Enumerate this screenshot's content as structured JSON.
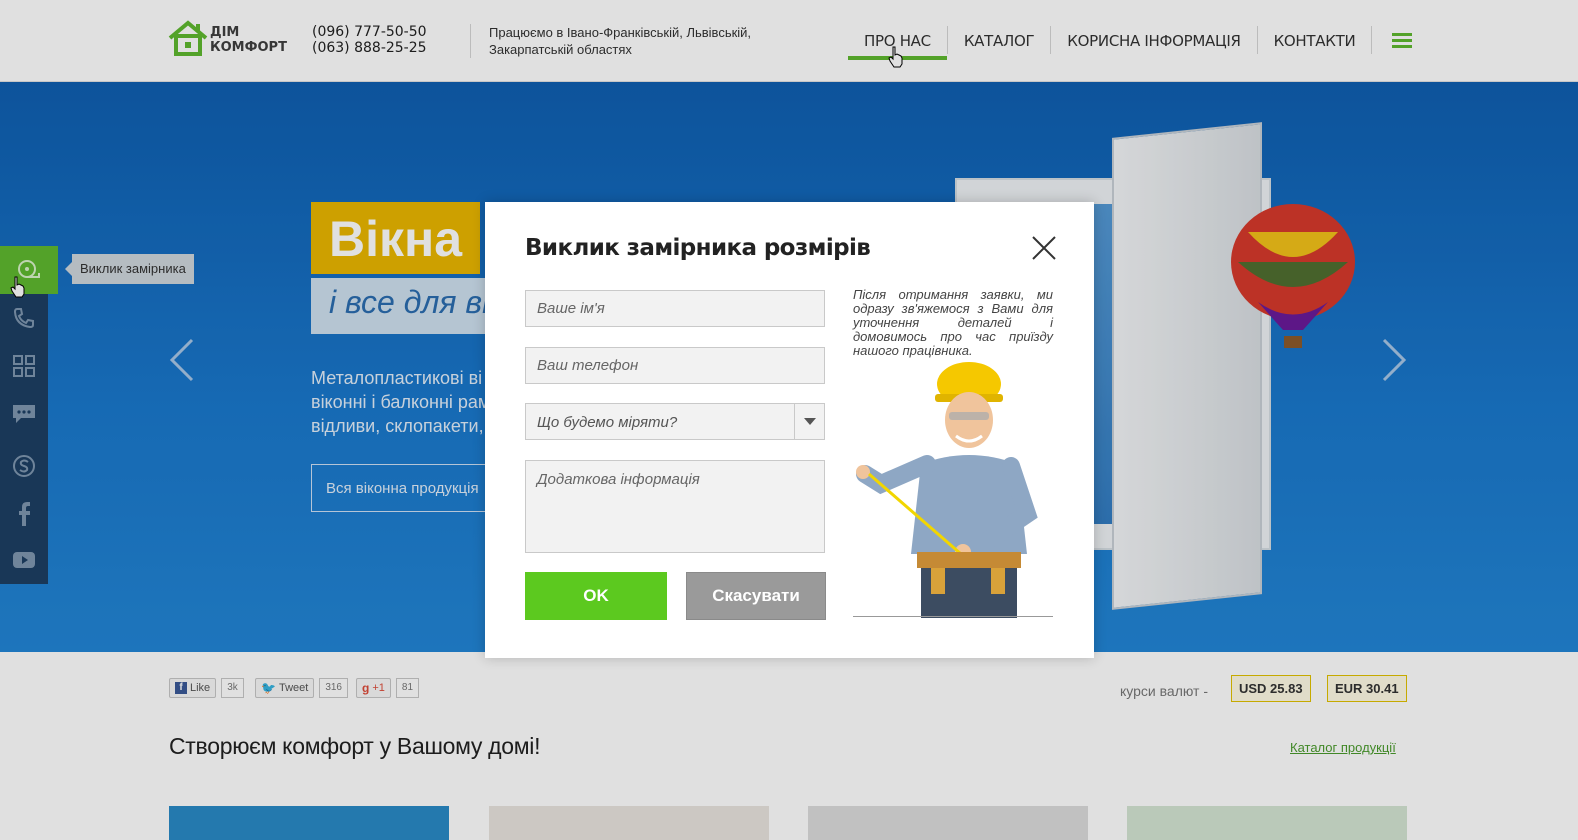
{
  "header": {
    "logo_text_line1": "ДІМ",
    "logo_text_line2": "КОМФОРТ",
    "phone1": "(096) 777-50-50",
    "phone2": "(063) 888-25-25",
    "regions": "Працюємо в Івано-Франківській, Львівській, Закарпатській областях",
    "nav": [
      {
        "label": "ПРО НАС",
        "active": true
      },
      {
        "label": "КАТАЛОГ",
        "active": false
      },
      {
        "label": "КОРИСНА ІНФОРМАЦІЯ",
        "active": false
      },
      {
        "label": "КОНТАКТИ",
        "active": false
      }
    ],
    "menu_icon": "hamburger-icon"
  },
  "hero": {
    "title": "Вікна",
    "subtitle": "і все для ві",
    "description_lines": [
      "Металопластикові ві",
      "віконні і балконні рам",
      "відливи, склопакети,"
    ],
    "button_label": "Вся віконна продукція"
  },
  "sidebar": {
    "items": [
      {
        "icon": "measure-tape-icon",
        "active": true
      },
      {
        "icon": "phone-icon",
        "active": false
      },
      {
        "icon": "grid-icon",
        "active": false
      },
      {
        "icon": "chat-icon",
        "active": false
      },
      {
        "icon": "skype-icon",
        "active": false
      },
      {
        "icon": "facebook-icon",
        "active": false
      },
      {
        "icon": "youtube-icon",
        "active": false
      }
    ],
    "tooltip": "Виклик замірника"
  },
  "social": {
    "like_label": "Like",
    "like_count": "3k",
    "tweet_label": "Tweet",
    "tweet_count": "316",
    "gplus_label": "+1",
    "gplus_count": "81"
  },
  "currency": {
    "label": "курси валют -",
    "usd": "USD 25.83",
    "eur": "EUR 30.41"
  },
  "section": {
    "title": "Створюєм комфорт у Вашому домі!",
    "catalog_link": "Каталог продукції"
  },
  "modal": {
    "title": "Виклик замірника розмірів",
    "name_placeholder": "Ваше ім'я",
    "phone_placeholder": "Ваш телефон",
    "select_value": "Що будемо міряти?",
    "info_placeholder": "Додаткова інформація",
    "ok_label": "OK",
    "cancel_label": "Скасувати",
    "note": "Після отримання заявки, ми одразу зв'яжемося з Вами для уточнення деталей і домовимось про час приїзду нашого працівника."
  },
  "colors": {
    "accent_green": "#5fb92f",
    "ok_green": "#5cc91f",
    "hero_blue": "#1a78cc",
    "title_yellow": "#eab700"
  }
}
